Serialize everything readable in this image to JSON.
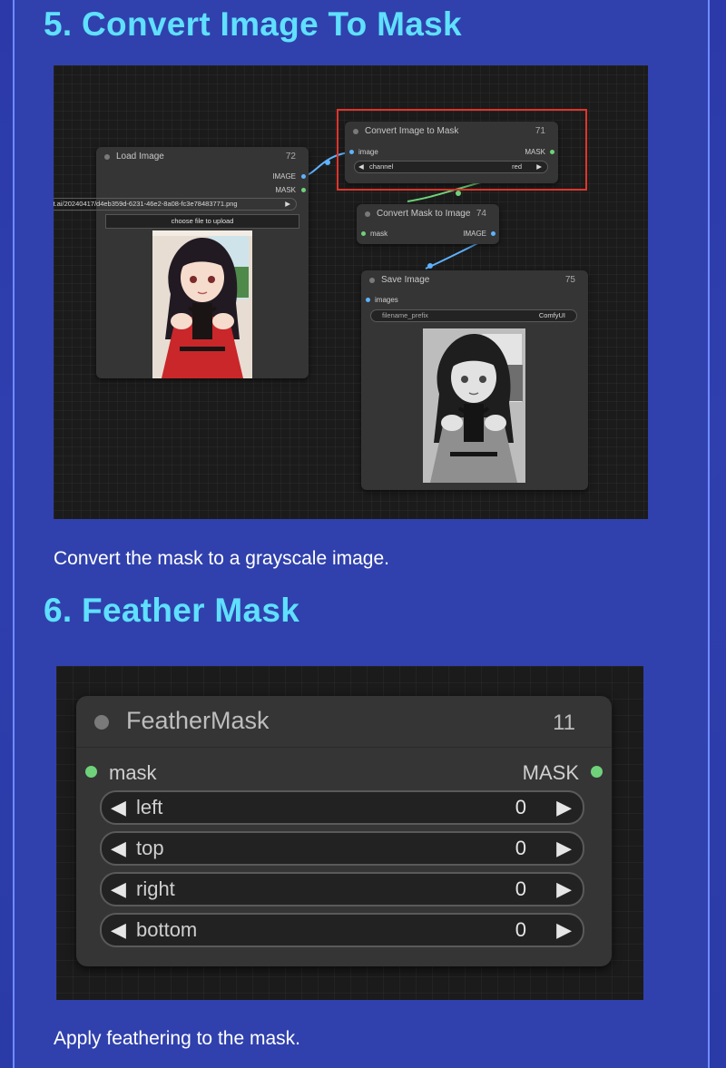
{
  "section5": {
    "heading": "5. Convert Image To Mask",
    "caption": "Convert the mask to a grayscale image.",
    "load_image": {
      "title": "Load Image",
      "id": "72",
      "outputs": [
        "IMAGE",
        "MASK"
      ],
      "file_value": "rt.ai/20240417/d4eb359d-6231-46e2-8a08-fc3e78483771.png",
      "upload_button": "choose file to upload"
    },
    "convert_image_to_mask": {
      "title": "Convert Image to Mask",
      "id": "71",
      "input": "image",
      "output": "MASK",
      "widget_label": "channel",
      "widget_value": "red"
    },
    "convert_mask_to_image": {
      "title": "Convert Mask to Image",
      "id": "74",
      "input": "mask",
      "output": "IMAGE"
    },
    "save_image": {
      "title": "Save Image",
      "id": "75",
      "input": "images",
      "widget_label": "filename_prefix",
      "widget_value": "ComfyUI"
    },
    "highlight_color": "#e0352b"
  },
  "section6": {
    "heading": "6. Feather Mask",
    "caption": "Apply feathering to the mask.",
    "feather_mask": {
      "title": "FeatherMask",
      "id": "11",
      "input": "mask",
      "output": "MASK",
      "widgets": [
        {
          "label": "left",
          "value": "0"
        },
        {
          "label": "top",
          "value": "0"
        },
        {
          "label": "right",
          "value": "0"
        },
        {
          "label": "bottom",
          "value": "0"
        }
      ]
    }
  },
  "colors": {
    "heading": "#5fe0ff",
    "background": "#3041ad",
    "link_image": "#5fb2ff",
    "link_mask": "#6fd27a"
  }
}
